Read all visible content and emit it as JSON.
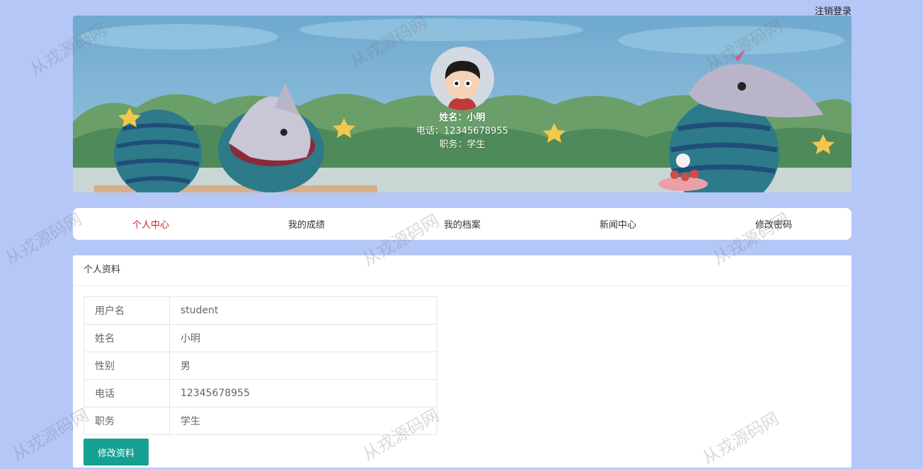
{
  "header": {
    "logout_label": "注销登录"
  },
  "profile": {
    "name_label": "姓名：",
    "name": "小明",
    "phone_label": "电话：",
    "phone": "12345678955",
    "job_label": "职务：",
    "job": "学生"
  },
  "nav": {
    "items": [
      {
        "label": "个人中心",
        "active": true
      },
      {
        "label": "我的成绩"
      },
      {
        "label": "我的档案"
      },
      {
        "label": "新闻中心"
      },
      {
        "label": "修改密码"
      }
    ]
  },
  "panel": {
    "title": "个人资料",
    "rows": [
      {
        "key": "用户名",
        "value": "student"
      },
      {
        "key": "姓名",
        "value": "小明"
      },
      {
        "key": "性别",
        "value": "男"
      },
      {
        "key": "电话",
        "value": "12345678955"
      },
      {
        "key": "职务",
        "value": "学生"
      }
    ],
    "edit_label": "修改资料"
  },
  "watermark": {
    "text": "从戎源码网"
  },
  "colors": {
    "accent": "#16a093",
    "nav_active": "#e0141e",
    "page_bg": "#b4c7f7"
  }
}
